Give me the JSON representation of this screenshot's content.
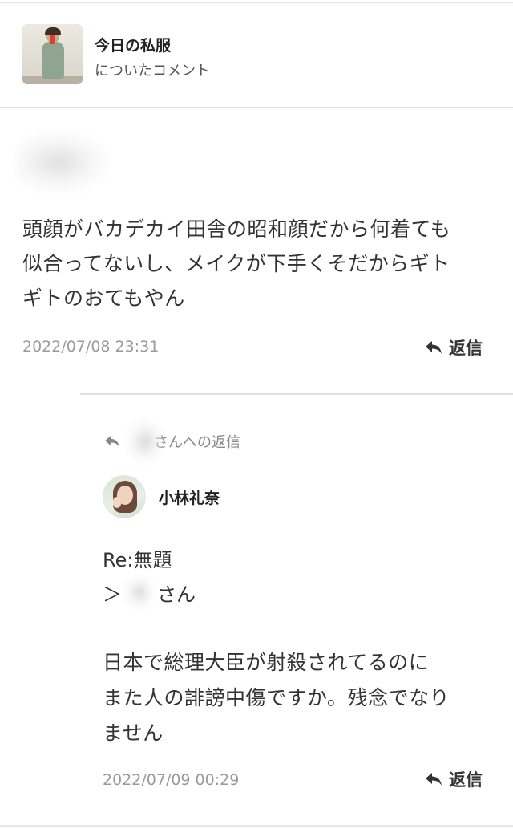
{
  "post": {
    "title": "今日の私服",
    "subtitle": "についたコメント",
    "thumbnail_icon": "outfit-photo-thumbnail"
  },
  "comment": {
    "author_hidden": true,
    "text": "頭顔がバカデカイ田舎の昭和顔だから何着ても\n似合ってないし、メイクが下手くそだからギト\nギトのおてもやん",
    "date": "2022/07/08 23:31",
    "reply_label": "返信",
    "reply_icon": "reply-arrow-icon"
  },
  "reply": {
    "reply_to_suffix": "さんへの返信",
    "reply_to_icon": "reply-arrow-icon",
    "author_name": "小林礼奈",
    "avatar_icon": "user-avatar",
    "subject": "Re:無題",
    "mention_prefix": "＞",
    "mention_suffix": "さん",
    "body": "日本で総理大臣が射殺されてるのに\nまた人の誹謗中傷ですか。残念でなり\nません",
    "date": "2022/07/09 00:29",
    "reply_label": "返信",
    "reply_icon": "reply-arrow-icon"
  },
  "colors": {
    "text": "#333333",
    "muted": "#9a9a9a",
    "divider": "#e0e0e0",
    "background": "#ffffff"
  }
}
